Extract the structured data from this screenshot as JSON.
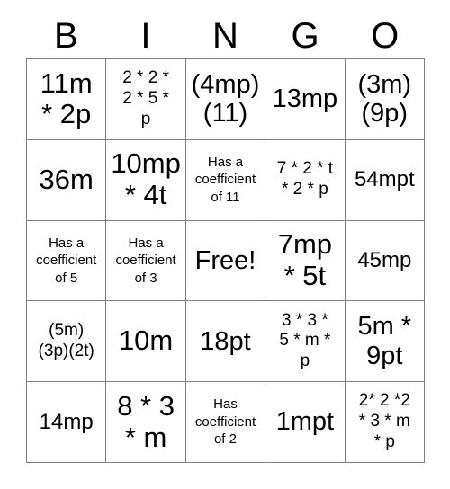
{
  "card": {
    "headers": [
      "B",
      "I",
      "N",
      "G",
      "O"
    ],
    "rows": [
      [
        {
          "text": "11m\n* 2p",
          "size": "xl"
        },
        {
          "text": "2 * 2 *\n2 * 5 *\np",
          "size": "sm"
        },
        {
          "text": "(4mp)\n(11)",
          "size": "lg"
        },
        {
          "text": "13mp",
          "size": "lg"
        },
        {
          "text": "(3m)\n(9p)",
          "size": "lg"
        }
      ],
      [
        {
          "text": "36m",
          "size": "xl"
        },
        {
          "text": "10mp\n* 4t",
          "size": "xl"
        },
        {
          "text": "Has a\ncoefficient\nof 11",
          "size": "xs"
        },
        {
          "text": "7 * 2 * t\n* 2 * p",
          "size": "sm"
        },
        {
          "text": "54mpt",
          "size": "md"
        }
      ],
      [
        {
          "text": "Has a\ncoefficient\nof 5",
          "size": "xs"
        },
        {
          "text": "Has a\ncoefficient\nof 3",
          "size": "xs"
        },
        {
          "text": "Free!",
          "size": "lg"
        },
        {
          "text": "7mp\n* 5t",
          "size": "xl"
        },
        {
          "text": "45mp",
          "size": "md"
        }
      ],
      [
        {
          "text": "(5m)\n(3p)(2t)",
          "size": "sm"
        },
        {
          "text": "10m",
          "size": "xl"
        },
        {
          "text": "18pt",
          "size": "lg"
        },
        {
          "text": "3 * 3 *\n5 * m *\np",
          "size": "sm"
        },
        {
          "text": "5m *\n9pt",
          "size": "lg"
        }
      ],
      [
        {
          "text": "14mp",
          "size": "md"
        },
        {
          "text": "8 * 3\n* m",
          "size": "xl"
        },
        {
          "text": "Has\ncoefficient\nof 2",
          "size": "xs"
        },
        {
          "text": "1mpt",
          "size": "lg"
        },
        {
          "text": "2* 2 *2\n* 3 * m\n* p",
          "size": "sm"
        }
      ]
    ]
  },
  "colors": {
    "grid_line": "#808080",
    "text": "#000000",
    "background": "#ffffff"
  }
}
